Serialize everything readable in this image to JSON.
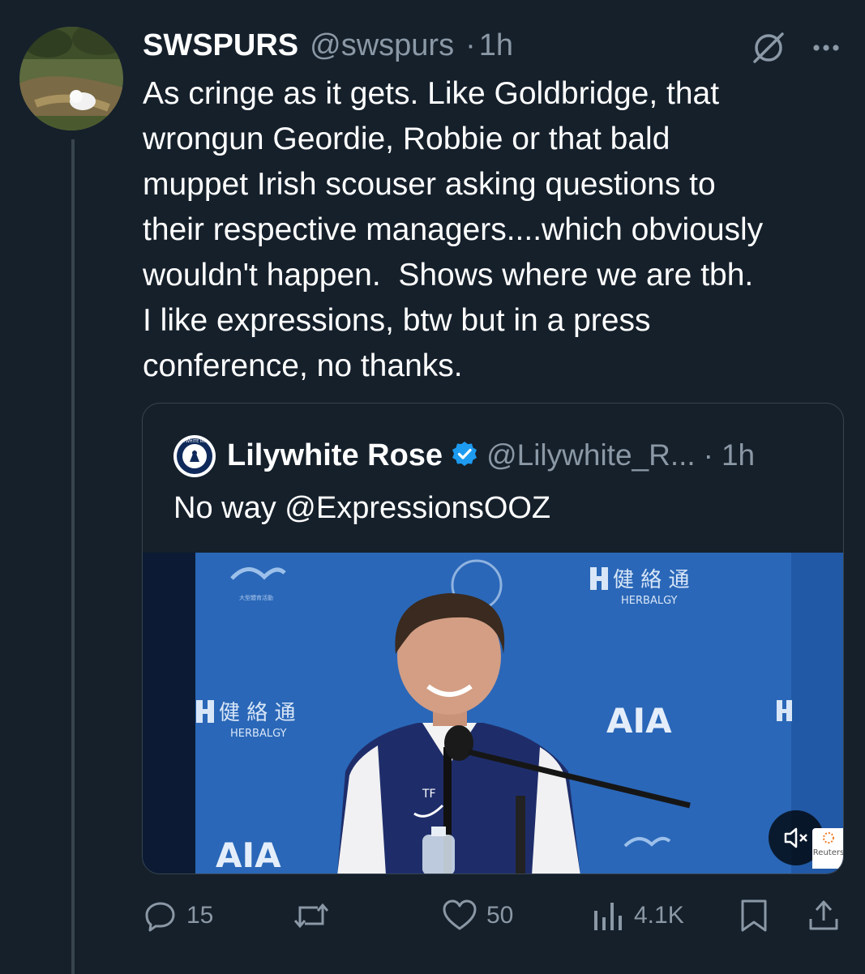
{
  "tweet": {
    "display_name": "SWSPURS",
    "handle": "@swspurs",
    "separator": "·",
    "time": "1h",
    "text": "As cringe as it gets. Like Goldbridge, that\nwrongun Geordie, Robbie or that bald\nmuppet Irish scouser asking questions to\ntheir respective managers....which obviously\nwouldn't happen.  Shows where we are tbh.\nI like expressions, btw but in a press\nconference, no thanks.",
    "grok_icon": "grok-icon",
    "more_icon": "more-icon"
  },
  "quote": {
    "display_name": "Lilywhite Rose",
    "verified_icon": "verified-badge-icon",
    "handle": "@Lilywhite_R...",
    "separator": "·",
    "time": "1h",
    "text": "No way @ExpressionsOOZ",
    "logo_text": "LILYWHITE ROSE",
    "media": {
      "herbalgy_cn": "健 絡 通",
      "herbalgy_en": "HERBALGY",
      "aia": "AIA",
      "shirt_initials": "TF",
      "reuters": "Reuters",
      "mute_icon": "volume-muted-icon"
    }
  },
  "actions": {
    "replies": "15",
    "reposts": "",
    "likes": "50",
    "views": "4.1K"
  },
  "colors": {
    "background": "#15202b",
    "secondary_text": "#8b98a5",
    "border": "#38444d",
    "verified": "#1d9bf0"
  }
}
